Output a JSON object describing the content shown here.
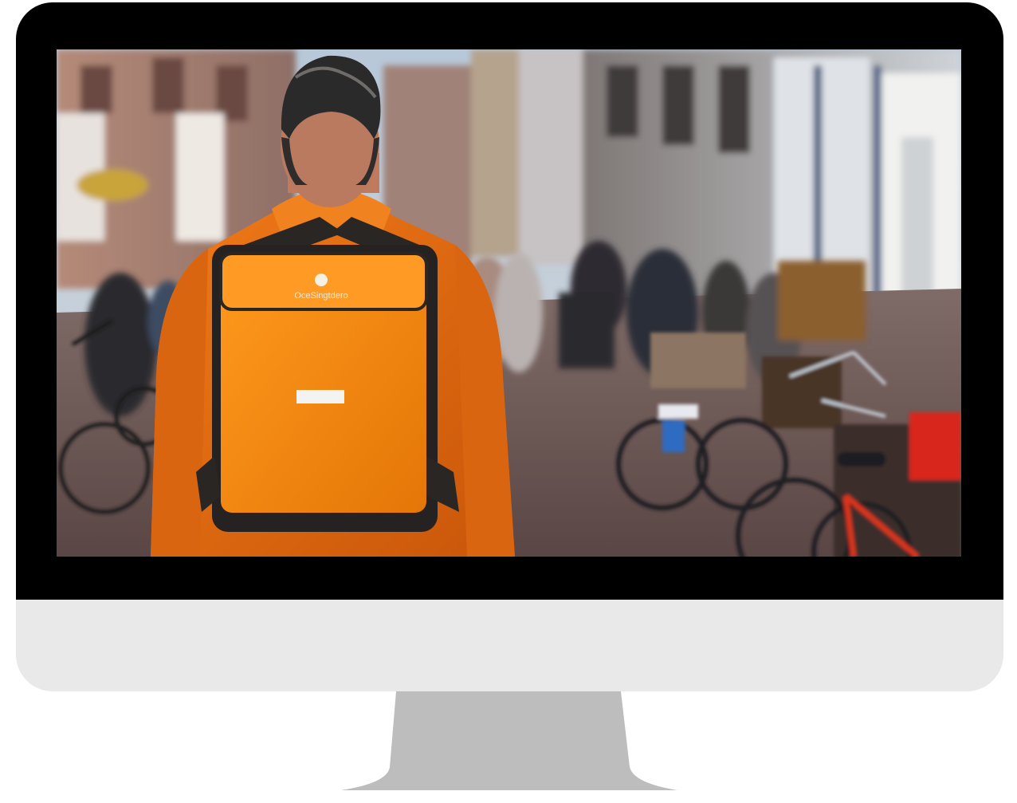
{
  "device": {
    "type": "desktop-monitor",
    "bezel_color": "#000000",
    "chin_color": "#e9e9e9",
    "stand_color": "#bdbdbd"
  },
  "screen": {
    "content": "photo",
    "backpack_label": "OceSingtdero",
    "colors": {
      "jacket": "#e86f12",
      "backpack": "#f48a10",
      "hair": "#2b2a2a",
      "street": "#6e5a57",
      "buildings": "#9b7d70"
    }
  }
}
